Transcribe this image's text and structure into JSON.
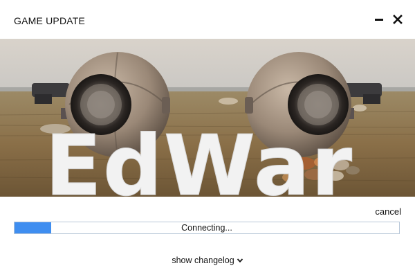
{
  "window": {
    "title": "GAME UPDATE",
    "minimize_icon": "minimize-icon",
    "close_icon": "close-icon"
  },
  "banner": {
    "logo_text": "EdWar",
    "description_icons": [
      "left-robot-drone",
      "right-robot-drone",
      "field-landscape"
    ]
  },
  "update": {
    "cancel_label": "cancel",
    "status_text": "Connecting...",
    "progress_fraction": 0.095,
    "progress_color": "#3f8ef0"
  },
  "footer": {
    "changelog_label": "show changelog",
    "chevron_icon": "chevron-down-icon"
  }
}
